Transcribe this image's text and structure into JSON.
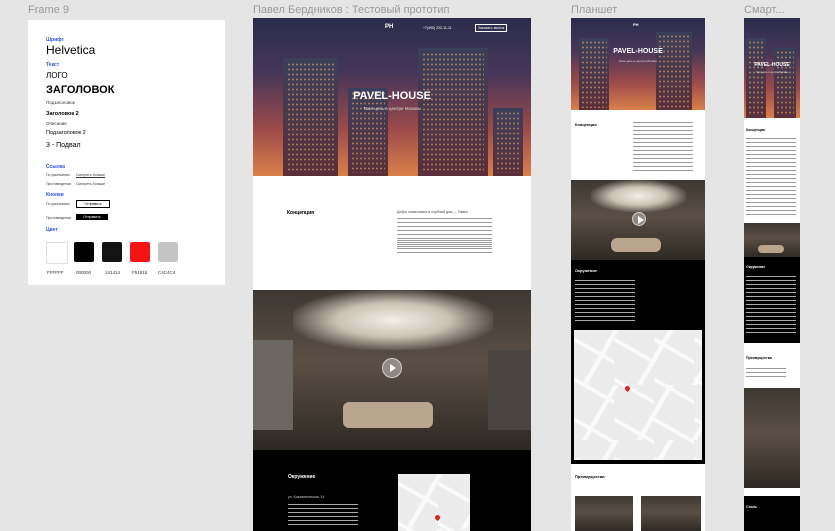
{
  "frames": {
    "style_label": "Frame 9",
    "desktop_label": "Павел Бердников : Тестовый прототип",
    "tablet_label": "Планшет",
    "mobile_label": "Смарт..."
  },
  "styleguide": {
    "font_heading": "Шрифт",
    "font_name": "Helvetica",
    "text_heading": "Текст",
    "logo": "ЛОГО",
    "title": "ЗАГОЛОВОК",
    "subtitle": "Подзаголовок",
    "heading2": "Заголовок 2",
    "body": "Описание",
    "subheading2": "Подзаголовок 2",
    "footer": "3 - Подвал",
    "links_heading": "Ссылка",
    "link_normal_label": "По умолчанию",
    "link_normal_value": "Смотреть больше",
    "link_hover_label": "При наведении",
    "link_hover_value": "Смотреть больше",
    "buttons_heading": "Кнопки",
    "btn_normal_label": "По умолчанию",
    "btn_normal_text": "Отправить",
    "btn_hover_label": "При наведении",
    "btn_hover_text": "Отправить",
    "colors_heading": "Цвет",
    "colors": [
      {
        "hex": "#FFFFFF",
        "label": "FFFFFF"
      },
      {
        "hex": "#000000",
        "label": "000000"
      },
      {
        "hex": "#141414",
        "label": "141414"
      },
      {
        "hex": "#F51515",
        "label": "F51515"
      },
      {
        "hex": "#C4C4C4",
        "label": "C4C4C4"
      }
    ]
  },
  "desktop": {
    "logo": "PH",
    "phone": "+7(495) 222-11-11",
    "header_button": "Заказать звонок",
    "hero_title": "PAVEL-HOUSE",
    "hero_subtitle": "Твоя цель в центре Москвы",
    "concept_title": "Концепция",
    "concept_lead": "Добро пожаловать в клубный дом — Павел",
    "surroundings_title": "Окружение",
    "address": "ул. Кожевническая, 14"
  },
  "tablet": {
    "logo": "PH",
    "hero_title": "PAVEL-HOUSE",
    "hero_subtitle": "Твоя цель в центре Москвы",
    "concept_title": "Концепция",
    "surroundings_title": "Окружение",
    "advantages_title": "Преимущества"
  },
  "mobile": {
    "hero_title": "PAVEL-HOUSE",
    "hero_subtitle": "Твоя цель в центре Москвы",
    "concept_title": "Концепция",
    "surroundings_title": "Окружение",
    "advantages_title": "Преимущества",
    "style_title": "Стиль"
  }
}
